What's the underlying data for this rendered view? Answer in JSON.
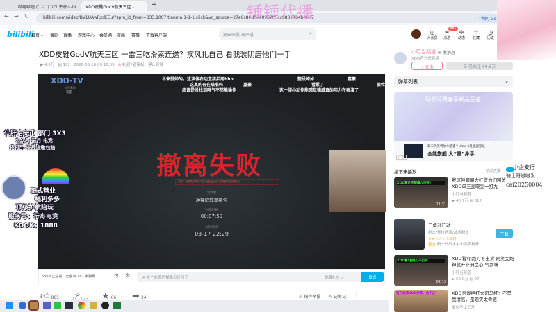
{
  "browser": {
    "tabs": [
      "哔哩哔哩 (゜-゜)つロ 干杯~-bi",
      "XDD皮鞋GodV航天三区 -"
    ],
    "url": "bilibili.com/video/BV1UAwRzdEEu/?spm_id_from=333.1007.tianma.1-1-1.click&vd_source=27e6c86d04a0962b5cc9807104bb677",
    "profile_btn": "询问 Go"
  },
  "watermark": "锤锤代播",
  "header": {
    "logo": "bilibili",
    "nav": [
      "首页 ▾",
      "番剧",
      "直播",
      "游戏中心",
      "会员购",
      "漫画",
      "赛事",
      "下载客户端"
    ],
    "search_placeholder": "深田咏美 双声道",
    "icons": [
      {
        "label": "大会员",
        "icon": "vip-icon"
      },
      {
        "label": "消息",
        "icon": "message-icon",
        "badge": "99+"
      },
      {
        "label": "动态",
        "icon": "dynamic-icon"
      },
      {
        "label": "收藏",
        "icon": "star-icon"
      },
      {
        "label": "历史",
        "icon": "history-icon"
      }
    ]
  },
  "video": {
    "title": "XDD皮鞋GodV航天三区 一雷三吃滑索连送？疾风扎自己 看我装阴唐他们一手",
    "views": "4.5万",
    "danmaku_count": "182",
    "date": "2026-03-18 00:16:39",
    "copyright": "未经作者授权，禁止转载",
    "logo": "XDD·TV",
    "logo_sub": [
      "航天基地",
      "德霸"
    ],
    "danmaku": [
      "本来挺帅的，这波偏右边直接拦尾hhh",
      "这真的有在瞄准吗",
      "应该是没找到啃气不然能操作",
      "嘉豪",
      "整段垮掉",
      "看累了",
      "这一缕小动作能感觉德威真的用力在表演了",
      "嘉豪",
      "很忙"
    ],
    "big_text": "撤离失败",
    "hint": "注意！你丢失了所有人员装备及战局中的物资作为战利品！",
    "labels": [
      "淘汰者",
      "冲锋陷阵蔷薇包",
      "时局时长",
      "00:07:59",
      "对局时间",
      "03-17 22:29"
    ],
    "overlay": [
      "代肝哈夫币 部门 3X3",
      "公众号 瑟月 电竞",
      "招打手 技号追缴包赔",
      "正式营业",
      "福利多多",
      "顶级护航陪玩",
      "服务号：行舟电竞",
      "KOOK：1888"
    ]
  },
  "player": {
    "watching": "588人正在看，已装填 182 条弹幕",
    "input_placeholder": "发个友善的弹幕见证当下",
    "etiquette": "弹幕礼仪 >",
    "send": "发送"
  },
  "actions": {
    "like": "885",
    "coin": "62",
    "fav": "66",
    "share": "34",
    "report": "稿件举报",
    "note": "记笔记"
  },
  "uploader": {
    "name": "小叮当频道",
    "message": "发消息",
    "desc": "XDD官方视频组",
    "charge": "充电",
    "follow": "已关注 69.8万"
  },
  "danmaku_list": "弹幕列表",
  "ad": {
    "headline": "联想消费春季新品品鉴",
    "line1": "新三代英特尔®酷睿™Ultra X处理器登录",
    "line2": "全能旗舰 大“显”身手",
    "tag": "广告"
  },
  "next": {
    "label": "接下来播放",
    "autoplay": "自动连播"
  },
  "recs": [
    {
      "title": "我这神眼圈大红警你们叫爸 XDD单三麦晓雯一打九",
      "up": "小叮当频道",
      "views": "40.7万",
      "dm": "812",
      "dur": "11:31",
      "thumb": "XDD看这把眼睛九连胜！"
    },
    {
      "title": "三角洲行动",
      "cat": "射击/竞技游戏/战术射击",
      "rating": "3.3分",
      "tag": "官方",
      "desc": "新一代战术射击品质标杆",
      "btn": "下载"
    },
    {
      "title": "XDD看YJJ跑刀不出货 刚笑完炮神就开非洲之心 气到嘴...",
      "up": "小叮当频道",
      "views": "60.0万",
      "dm": "97",
      "dur": "02:13",
      "thumb": "XDD看YJJ跑刀不出货"
    },
    {
      "title": "XDD吾谈拒打大司马杯：不是我清高，是现实太骨感！",
      "up": "爱你不止三万",
      "thumb": "官方邀请XDD参赛，他不去?"
    }
  ],
  "overlay_right": [
    "小企麦行",
    "骑士哥嗷嗷发",
    "cai20250004"
  ]
}
